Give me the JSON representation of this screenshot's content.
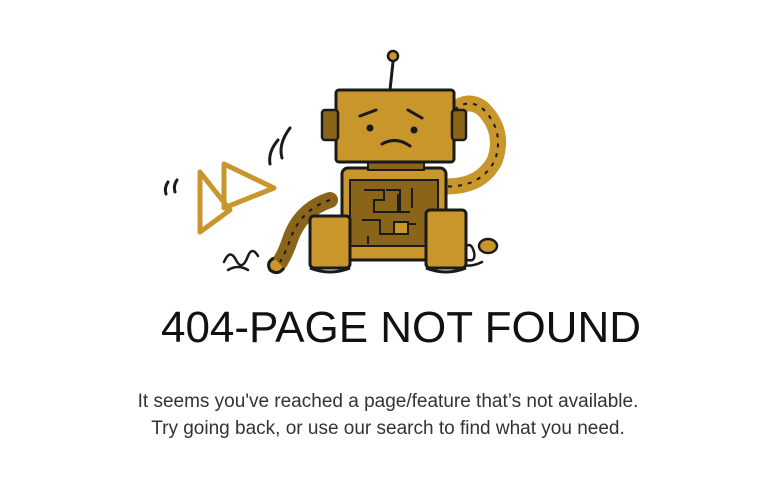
{
  "error": {
    "title": "404-PAGE NOT FOUND",
    "message_line1": "It seems you've reached a page/feature that’s not available.",
    "message_line2": "Try going back, or use our search to find what you need."
  },
  "illustration": {
    "icon": "sad-robot-icon",
    "logo_icon": "play-triangle-logo-icon",
    "colors": {
      "robot_body": "#c8962b",
      "robot_shadow": "#8a6419",
      "outline": "#1a1a1a",
      "logo": "#c8962b"
    }
  }
}
